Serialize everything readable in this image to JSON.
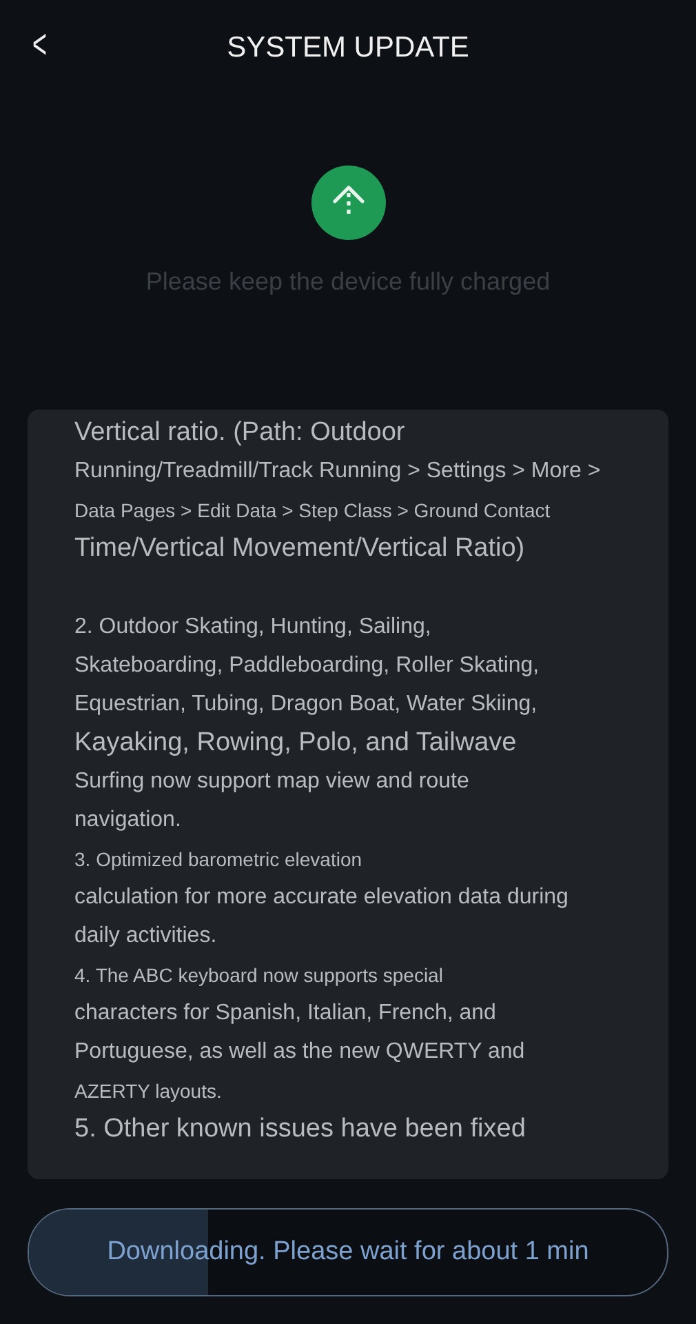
{
  "header": {
    "back": "<",
    "title": "SYSTEM UPDATE"
  },
  "notice": "Please keep the device fully charged",
  "paragraphs": [
    {
      "lines": [
        {
          "text": "Vertical ratio. (Path: Outdoor",
          "kind": "large"
        },
        {
          "text": "Running/Treadmill/Track Running > Settings > More >",
          "kind": "medium"
        },
        {
          "text": "Data Pages > Edit Data > Step Class > Ground Contact",
          "kind": "small"
        },
        {
          "text": "Time/Vertical Movement/Vertical Ratio)",
          "kind": "large"
        }
      ]
    },
    {
      "lines": [
        {
          "text": "2. Outdoor Skating, Hunting, Sailing,",
          "kind": "medium"
        },
        {
          "text": "Skateboarding, Paddleboarding, Roller Skating,",
          "kind": "medium"
        },
        {
          "text": "Equestrian, Tubing, Dragon Boat, Water Skiing,",
          "kind": "medium"
        },
        {
          "text": "Kayaking, Rowing, Polo, and Tailwave",
          "kind": "large"
        },
        {
          "text": "Surfing now support map view and route",
          "kind": "medium"
        },
        {
          "text": "navigation.",
          "kind": "medium"
        },
        {
          "text": "3. Optimized barometric elevation",
          "kind": "small"
        },
        {
          "text": "calculation for more accurate elevation data during",
          "kind": "medium"
        },
        {
          "text": "daily activities.",
          "kind": "medium"
        },
        {
          "text": "4. The ABC keyboard now supports special",
          "kind": "small"
        },
        {
          "text": "characters for Spanish, Italian, French, and",
          "kind": "medium"
        },
        {
          "text": "Portuguese, as well as the new QWERTY and",
          "kind": "medium"
        },
        {
          "text": "AZERTY layouts.",
          "kind": "small"
        },
        {
          "text": "5. Other known issues have been fixed",
          "kind": "large"
        }
      ]
    }
  ],
  "download": {
    "label": "Downloading. Please wait for about 1 min",
    "level": 0.28
  }
}
